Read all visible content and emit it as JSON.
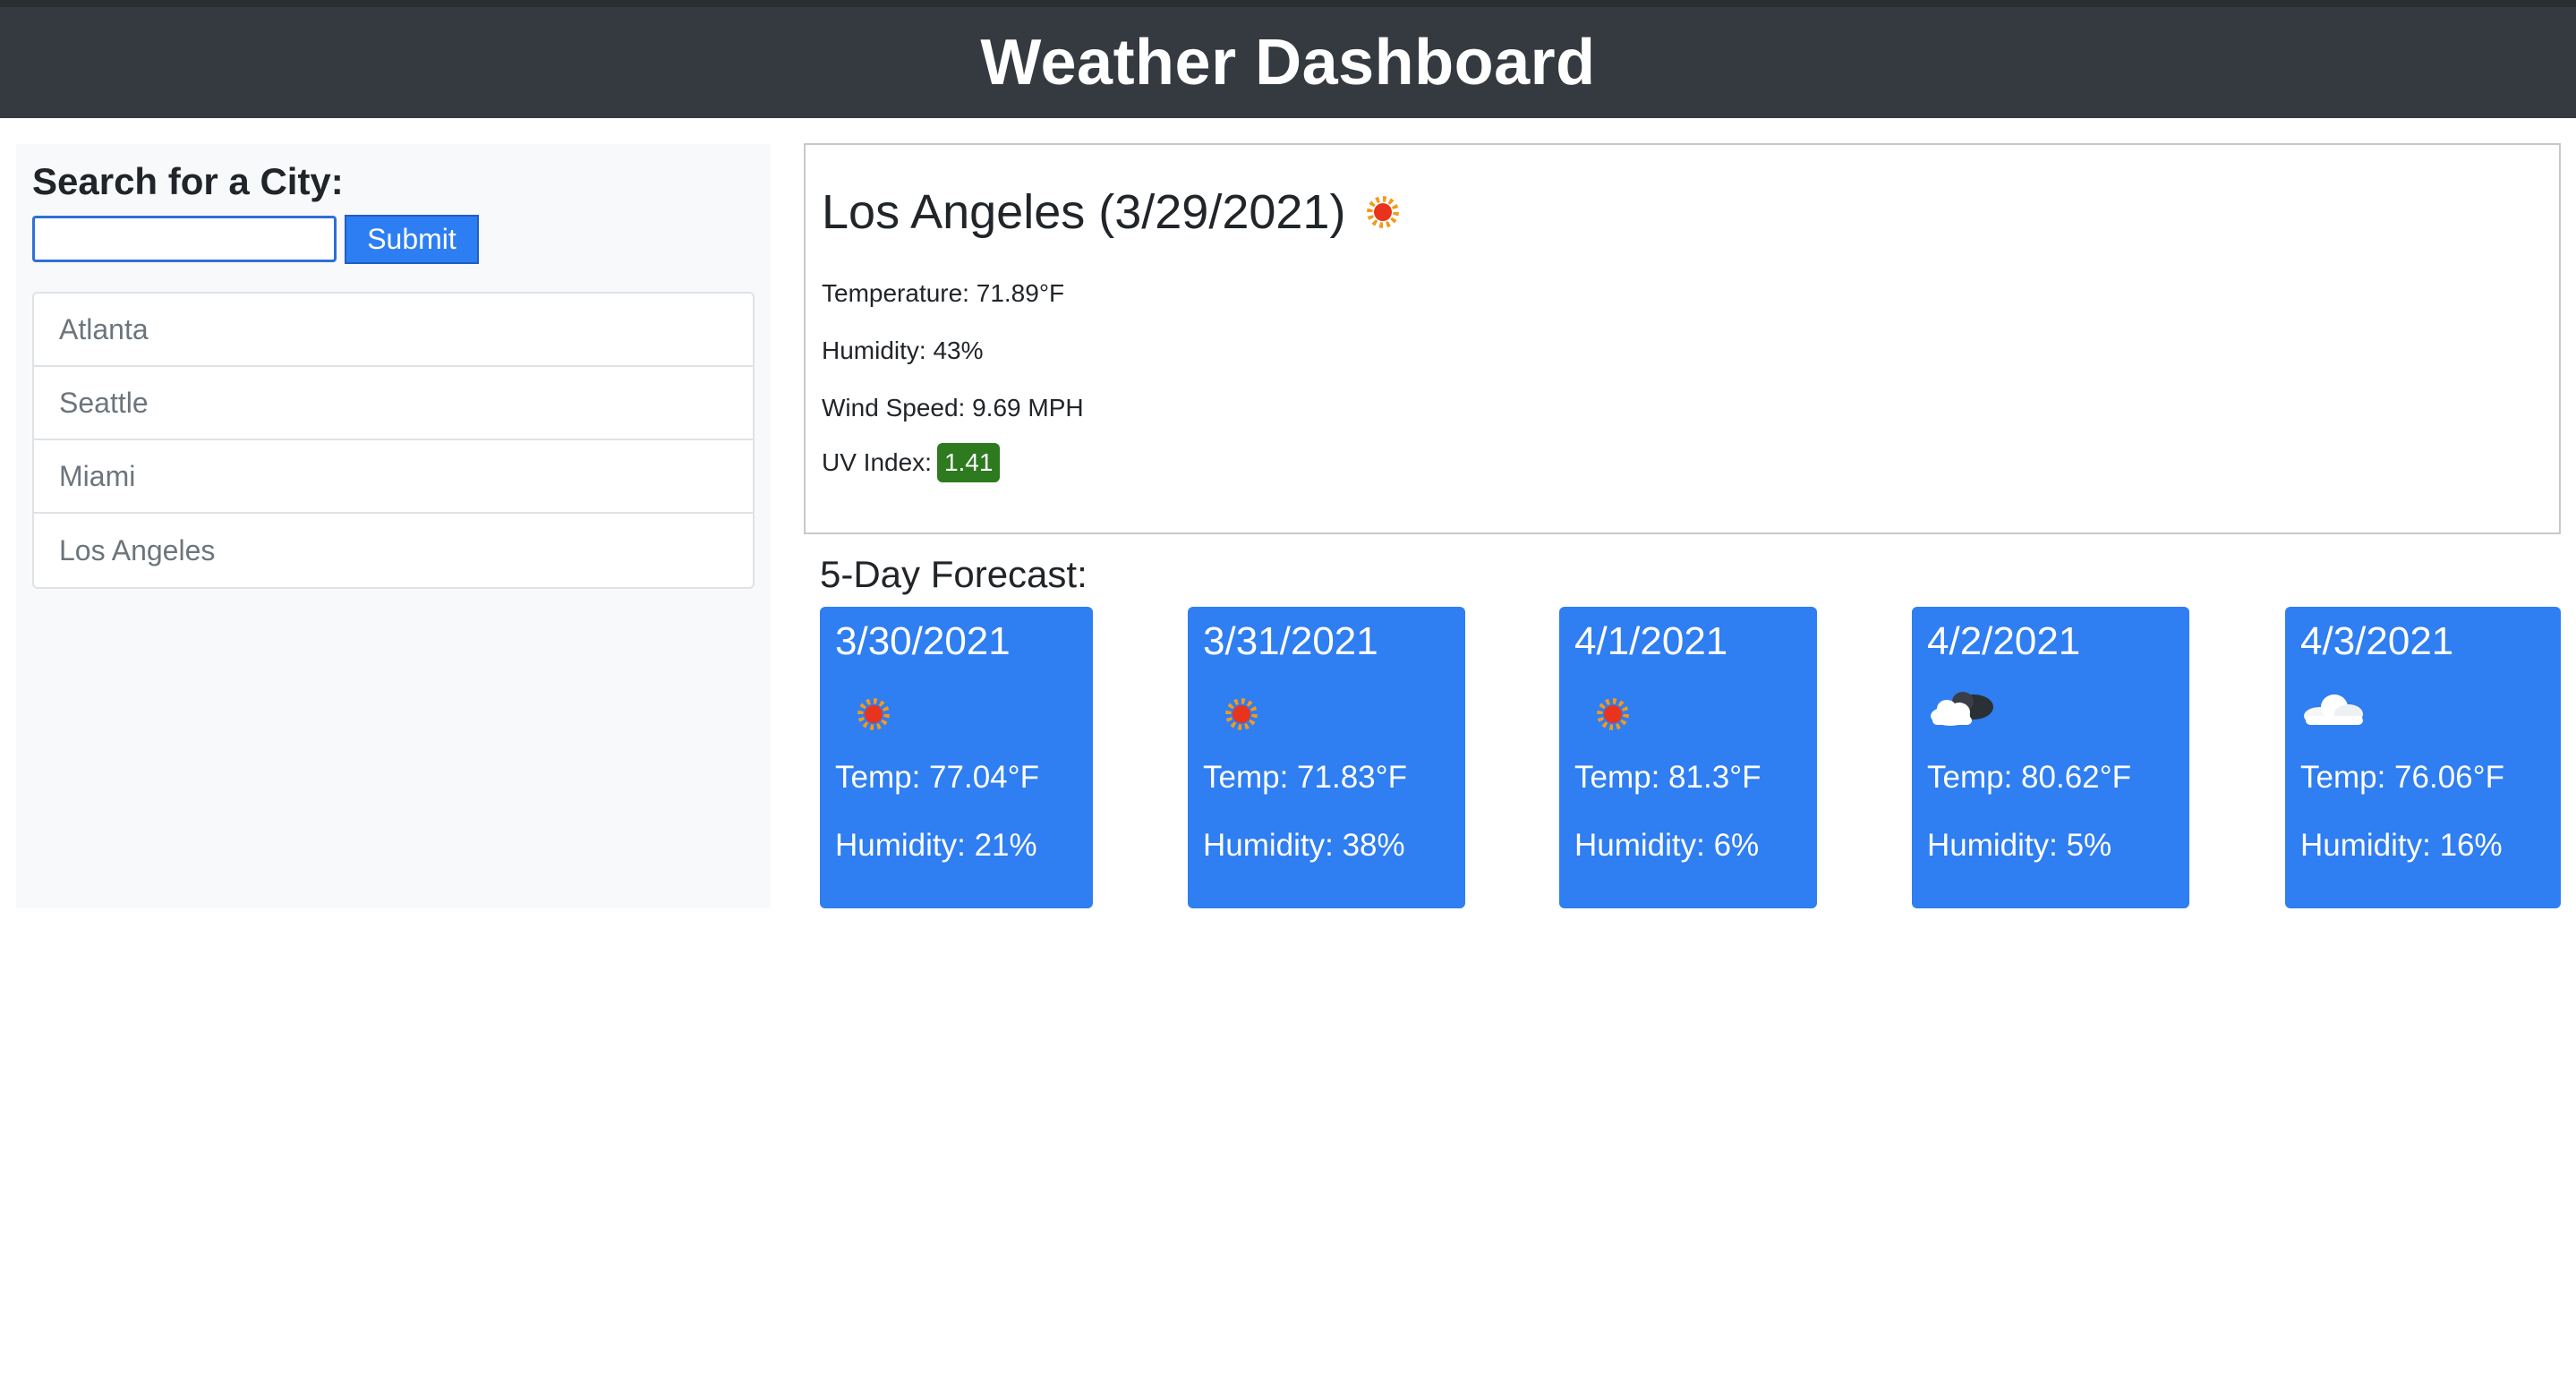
{
  "header": {
    "title": "Weather Dashboard"
  },
  "sidebar": {
    "search_label": "Search for a City:",
    "search_value": "",
    "submit_label": "Submit",
    "history": [
      "Atlanta",
      "Seattle",
      "Miami",
      "Los Angeles"
    ]
  },
  "current": {
    "title": "Los Angeles (3/29/2021)",
    "icon": "sun-icon",
    "temperature": "Temperature: 71.89°F",
    "humidity": "Humidity: 43%",
    "wind": "Wind Speed: 9.69 MPH",
    "uv_label": "UV Index:",
    "uv_value": "1.41",
    "uv_color": "#2d7a1f"
  },
  "forecast": {
    "title": "5-Day Forecast:",
    "card_color": "#2f7ef2",
    "days": [
      {
        "date": "3/30/2021",
        "icon": "sun-icon",
        "temp": "Temp: 77.04°F",
        "humidity": "Humidity: 21%"
      },
      {
        "date": "3/31/2021",
        "icon": "sun-icon",
        "temp": "Temp: 71.83°F",
        "humidity": "Humidity: 38%"
      },
      {
        "date": "4/1/2021",
        "icon": "sun-icon",
        "temp": "Temp: 81.3°F",
        "humidity": "Humidity: 6%"
      },
      {
        "date": "4/2/2021",
        "icon": "dark-cloud-icon",
        "temp": "Temp: 80.62°F",
        "humidity": "Humidity: 5%"
      },
      {
        "date": "4/3/2021",
        "icon": "cloud-icon",
        "temp": "Temp: 76.06°F",
        "humidity": "Humidity: 16%"
      }
    ]
  }
}
